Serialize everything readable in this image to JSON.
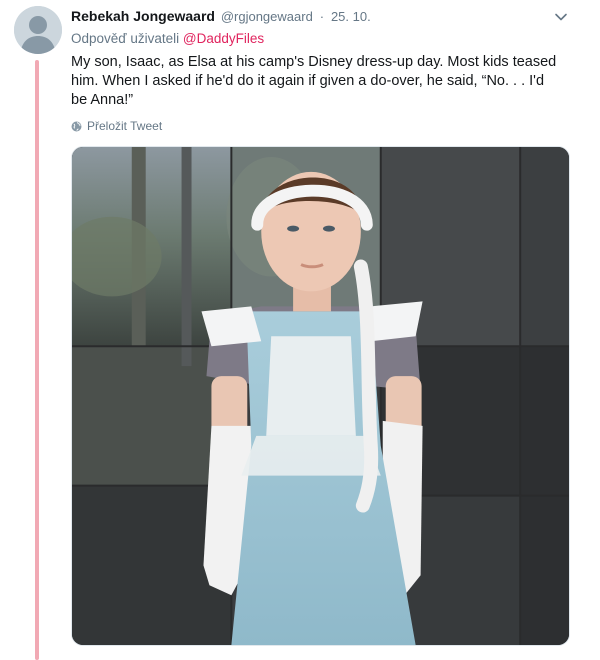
{
  "tweet": {
    "author_name": "Rebekah Jongewaard",
    "author_handle": "@rgjongewaard",
    "separator": "·",
    "date": "25. 10.",
    "reply_prefix": "Odpověď uživateli",
    "reply_mention": "@DaddyFiles",
    "text": "My son, Isaac, as Elsa at his camp's Disney dress-up day. Most kids teased him. When I asked if he'd do it again if given a do-over, he said, “No. . . I'd be Anna!”",
    "translate_label": "Přeložit Tweet"
  },
  "icons": {
    "avatar": "default-avatar-icon",
    "more": "chevron-down-icon",
    "translate": "globe-icon"
  },
  "colors": {
    "mention": "#e0245e",
    "thread_line": "#f1a9b4",
    "secondary_text": "#657786"
  }
}
